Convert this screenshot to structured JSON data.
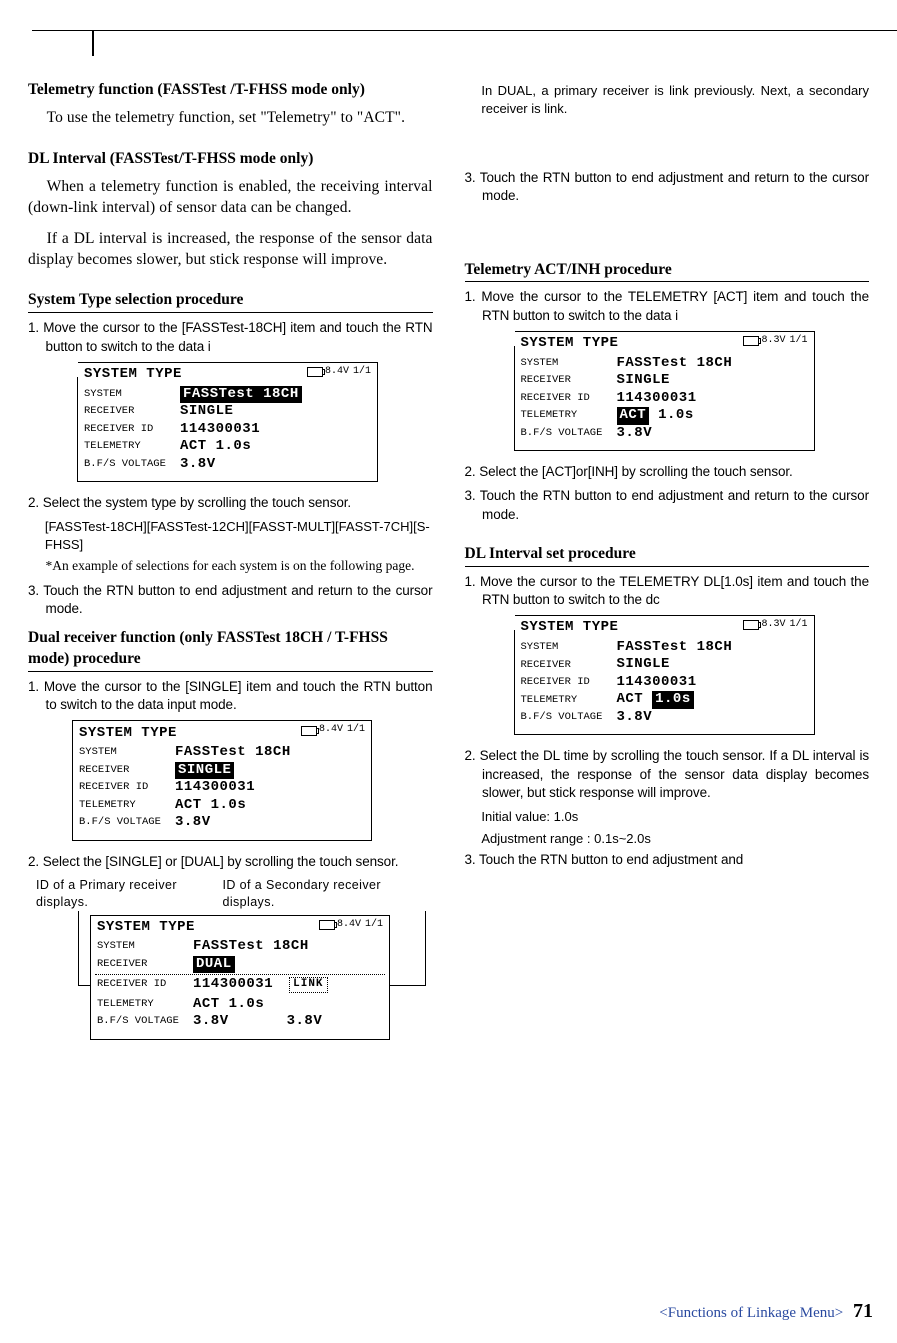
{
  "left": {
    "sec1_title": "Telemetry function (FASSTest /T-FHSS mode only)",
    "sec1_body": "To use the telemetry function, set \"Telemetry\" to \"ACT\".",
    "sec2_title": "DL Interval (FASSTest/T-FHSS  mode only)",
    "sec2_body1": "When a telemetry function is enabled, the receiving interval (down-link interval) of sensor data can be changed.",
    "sec2_body2": "If a DL interval is increased, the  response of the sensor data display becomes slower, but stick response will improve.",
    "sec3_title": "System Type selection procedure",
    "sec3_step1": "1. Move the cursor to the [FASSTest-18CH] item and touch the RTN button to switch to the data i",
    "sec3_step2": "2. Select the system type by scrolling the touch sensor.",
    "sec3_step2_sub": "[FASSTest-18CH][FASSTest-12CH][FASST-MULT][FASST-7CH][S-FHSS]",
    "sec3_step2_note": "*An example of selections for each system is on the following page.",
    "sec3_step3": "3. Touch the RTN button to end adjustment and return to the cursor mode.",
    "sec4_title": "Dual receiver function (only FASSTest 18CH / T-FHSS mode) procedure",
    "sec4_step1": "1. Move the cursor to the [SINGLE] item and touch the RTN button to switch to the data input mode.",
    "sec4_step2": "2. Select the [SINGLE] or [DUAL] by scrolling the touch sensor.",
    "callout_left": "ID of a Primary receiver displays.",
    "callout_right": "ID of a Secondary receiver displays."
  },
  "right": {
    "top1": "In DUAL, a primary receiver is link previously. Next, a secondary receiver is link.",
    "top_step3": "3. Touch the RTN button to end adjustment and return to the cursor mode.",
    "sec5_title": "Telemetry ACT/INH procedure",
    "sec5_step1": "1. Move the cursor to the TELEMETRY [ACT] item and touch the RTN button to switch to the data i",
    "sec5_step2": "2. Select the [ACT]or[INH] by scrolling the touch sensor.",
    "sec5_step3": "3. Touch the RTN button to end adjustment and return to the cursor mode.",
    "sec6_title": "DL Interval set procedure",
    "sec6_step1": "1. Move the cursor to the TELEMETRY DL[1.0s] item and touch the RTN button to switch to the dc",
    "sec6_step2": "2. Select the DL time by scrolling the touch sensor. If a DL interval is increased, the response of the sensor data display becomes slower, but stick response will improve.",
    "sec6_step2_sub1": "Initial value: 1.0s",
    "sec6_step2_sub2": "Adjustment range : 0.1s~2.0s",
    "sec6_step3": "3. Touch the RTN button to end adjustment and"
  },
  "ss": {
    "title": "SYSTEM TYPE",
    "batt_84": "8.4V",
    "batt_83": "8.3V",
    "page": "1/1",
    "label_system": "SYSTEM",
    "label_receiver": "RECEIVER",
    "label_receiver_id": "RECEIVER ID",
    "label_telemetry": "TELEMETRY",
    "label_voltage": "B.F/S VOLTAGE",
    "v_system_plain": "FASSTest 18CH",
    "v_single": "SINGLE",
    "v_dual": "DUAL",
    "v_rxid": "114300031",
    "v_act": "ACT",
    "v_10s": "1.0s",
    "v_38v": "3.8V",
    "v_link": "LINK"
  },
  "footer_label": "<Functions of Linkage Menu>",
  "footer_page": "71"
}
